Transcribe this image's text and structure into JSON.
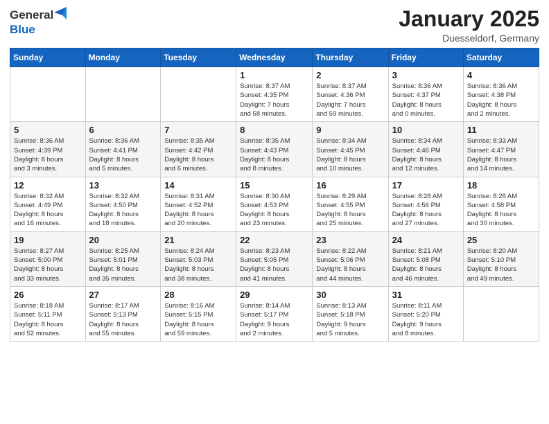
{
  "header": {
    "logo_general": "General",
    "logo_blue": "Blue",
    "title": "January 2025",
    "location": "Duesseldorf, Germany"
  },
  "days_of_week": [
    "Sunday",
    "Monday",
    "Tuesday",
    "Wednesday",
    "Thursday",
    "Friday",
    "Saturday"
  ],
  "weeks": [
    [
      {
        "day": "",
        "info": ""
      },
      {
        "day": "",
        "info": ""
      },
      {
        "day": "",
        "info": ""
      },
      {
        "day": "1",
        "info": "Sunrise: 8:37 AM\nSunset: 4:35 PM\nDaylight: 7 hours\nand 58 minutes."
      },
      {
        "day": "2",
        "info": "Sunrise: 8:37 AM\nSunset: 4:36 PM\nDaylight: 7 hours\nand 59 minutes."
      },
      {
        "day": "3",
        "info": "Sunrise: 8:36 AM\nSunset: 4:37 PM\nDaylight: 8 hours\nand 0 minutes."
      },
      {
        "day": "4",
        "info": "Sunrise: 8:36 AM\nSunset: 4:38 PM\nDaylight: 8 hours\nand 2 minutes."
      }
    ],
    [
      {
        "day": "5",
        "info": "Sunrise: 8:36 AM\nSunset: 4:39 PM\nDaylight: 8 hours\nand 3 minutes."
      },
      {
        "day": "6",
        "info": "Sunrise: 8:36 AM\nSunset: 4:41 PM\nDaylight: 8 hours\nand 5 minutes."
      },
      {
        "day": "7",
        "info": "Sunrise: 8:35 AM\nSunset: 4:42 PM\nDaylight: 8 hours\nand 6 minutes."
      },
      {
        "day": "8",
        "info": "Sunrise: 8:35 AM\nSunset: 4:43 PM\nDaylight: 8 hours\nand 8 minutes."
      },
      {
        "day": "9",
        "info": "Sunrise: 8:34 AM\nSunset: 4:45 PM\nDaylight: 8 hours\nand 10 minutes."
      },
      {
        "day": "10",
        "info": "Sunrise: 8:34 AM\nSunset: 4:46 PM\nDaylight: 8 hours\nand 12 minutes."
      },
      {
        "day": "11",
        "info": "Sunrise: 8:33 AM\nSunset: 4:47 PM\nDaylight: 8 hours\nand 14 minutes."
      }
    ],
    [
      {
        "day": "12",
        "info": "Sunrise: 8:32 AM\nSunset: 4:49 PM\nDaylight: 8 hours\nand 16 minutes."
      },
      {
        "day": "13",
        "info": "Sunrise: 8:32 AM\nSunset: 4:50 PM\nDaylight: 8 hours\nand 18 minutes."
      },
      {
        "day": "14",
        "info": "Sunrise: 8:31 AM\nSunset: 4:52 PM\nDaylight: 8 hours\nand 20 minutes."
      },
      {
        "day": "15",
        "info": "Sunrise: 8:30 AM\nSunset: 4:53 PM\nDaylight: 8 hours\nand 23 minutes."
      },
      {
        "day": "16",
        "info": "Sunrise: 8:29 AM\nSunset: 4:55 PM\nDaylight: 8 hours\nand 25 minutes."
      },
      {
        "day": "17",
        "info": "Sunrise: 8:28 AM\nSunset: 4:56 PM\nDaylight: 8 hours\nand 27 minutes."
      },
      {
        "day": "18",
        "info": "Sunrise: 8:28 AM\nSunset: 4:58 PM\nDaylight: 8 hours\nand 30 minutes."
      }
    ],
    [
      {
        "day": "19",
        "info": "Sunrise: 8:27 AM\nSunset: 5:00 PM\nDaylight: 8 hours\nand 33 minutes."
      },
      {
        "day": "20",
        "info": "Sunrise: 8:25 AM\nSunset: 5:01 PM\nDaylight: 8 hours\nand 35 minutes."
      },
      {
        "day": "21",
        "info": "Sunrise: 8:24 AM\nSunset: 5:03 PM\nDaylight: 8 hours\nand 38 minutes."
      },
      {
        "day": "22",
        "info": "Sunrise: 8:23 AM\nSunset: 5:05 PM\nDaylight: 8 hours\nand 41 minutes."
      },
      {
        "day": "23",
        "info": "Sunrise: 8:22 AM\nSunset: 5:06 PM\nDaylight: 8 hours\nand 44 minutes."
      },
      {
        "day": "24",
        "info": "Sunrise: 8:21 AM\nSunset: 5:08 PM\nDaylight: 8 hours\nand 46 minutes."
      },
      {
        "day": "25",
        "info": "Sunrise: 8:20 AM\nSunset: 5:10 PM\nDaylight: 8 hours\nand 49 minutes."
      }
    ],
    [
      {
        "day": "26",
        "info": "Sunrise: 8:18 AM\nSunset: 5:11 PM\nDaylight: 8 hours\nand 52 minutes."
      },
      {
        "day": "27",
        "info": "Sunrise: 8:17 AM\nSunset: 5:13 PM\nDaylight: 8 hours\nand 55 minutes."
      },
      {
        "day": "28",
        "info": "Sunrise: 8:16 AM\nSunset: 5:15 PM\nDaylight: 8 hours\nand 59 minutes."
      },
      {
        "day": "29",
        "info": "Sunrise: 8:14 AM\nSunset: 5:17 PM\nDaylight: 9 hours\nand 2 minutes."
      },
      {
        "day": "30",
        "info": "Sunrise: 8:13 AM\nSunset: 5:18 PM\nDaylight: 9 hours\nand 5 minutes."
      },
      {
        "day": "31",
        "info": "Sunrise: 8:11 AM\nSunset: 5:20 PM\nDaylight: 9 hours\nand 8 minutes."
      },
      {
        "day": "",
        "info": ""
      }
    ]
  ]
}
